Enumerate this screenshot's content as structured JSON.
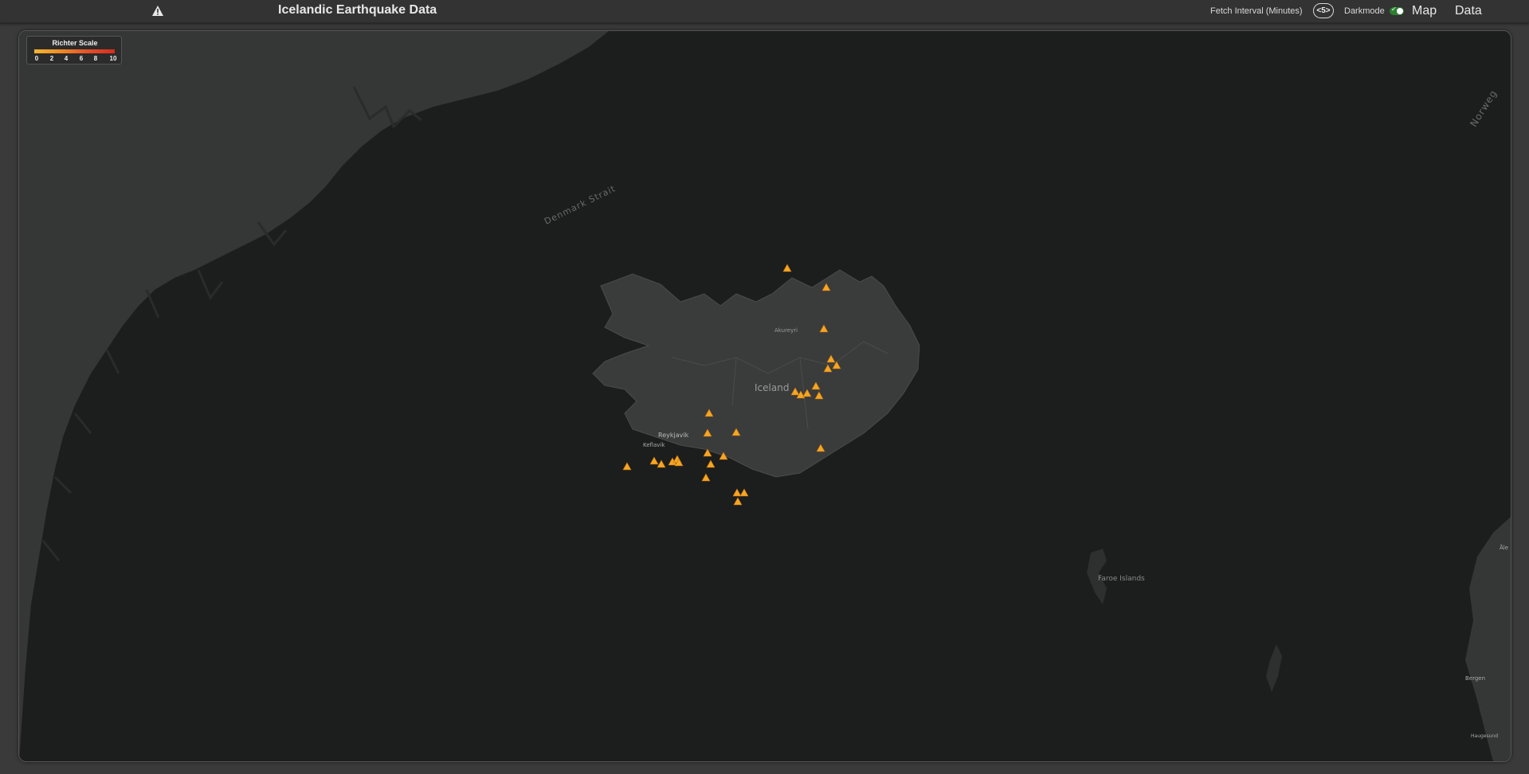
{
  "header": {
    "logo_icon": "warning-triangle-icon",
    "title": "Icelandic Earthquake Data",
    "fetch_interval_label": "Fetch Interval (Minutes)",
    "fetch_interval_value": "<5>",
    "darkmode_label": "Darkmode",
    "darkmode_enabled": true,
    "nav_map": "Map",
    "nav_data": "Data"
  },
  "legend": {
    "title": "Richter Scale",
    "ticks": [
      "0",
      "2",
      "4",
      "6",
      "8",
      "10"
    ],
    "colors": [
      "#f2b632",
      "#f08a24",
      "#e4502a",
      "#d62c1f"
    ]
  },
  "map": {
    "labels": {
      "denmark_strait": "Denmark Strait",
      "norwegian": "Norweg",
      "iceland": "Iceland",
      "akureyri": "Akureyri",
      "reykjavik": "Reykjavik",
      "keflavik": "Keflavík",
      "faroe": "Faroe Islands",
      "bergen": "Bergen",
      "haugesund": "Haugesund",
      "aalesund": "Åle"
    },
    "marker_icon": "earthquake-triangle-icon",
    "marker_color": "#f5a623"
  }
}
